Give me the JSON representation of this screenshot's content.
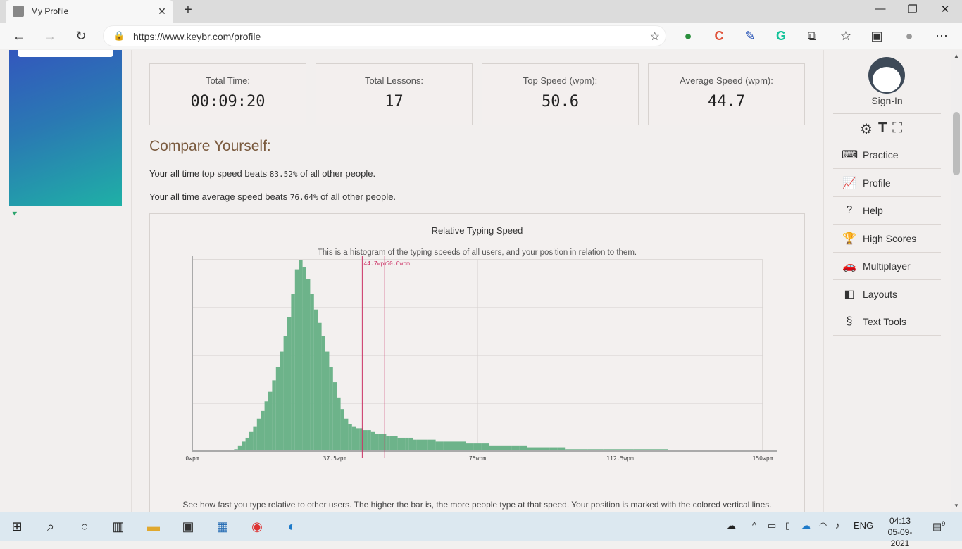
{
  "browser": {
    "tab_title": "My Profile",
    "url": "https://www.keybr.com/profile"
  },
  "stats": [
    {
      "label": "Total Time:",
      "value": "00:09:20"
    },
    {
      "label": "Total Lessons:",
      "value": "17"
    },
    {
      "label": "Top Speed (wpm):",
      "value": "50.6"
    },
    {
      "label": "Average Speed (wpm):",
      "value": "44.7"
    }
  ],
  "compare": {
    "title": "Compare Yourself:",
    "line1_pre": "Your all time top speed beats ",
    "line1_pct": "83.52%",
    "line1_post": " of all other people.",
    "line2_pre": "Your all time average speed beats ",
    "line2_pct": "76.64%",
    "line2_post": " of all other people."
  },
  "chart_data": {
    "type": "bar",
    "title": "Relative Typing Speed",
    "subtitle": "This is a histogram of the typing speeds of all users, and your position in relation to them.",
    "footer": "See how fast you type relative to other users. The higher the bar is, the more people type at that speed. Your position is marked with the colored vertical lines.",
    "xlim": [
      0,
      150
    ],
    "x_ticks": [
      "0wpm",
      "37.5wpm",
      "75wpm",
      "112.5wpm",
      "150wpm"
    ],
    "bar_color": "#6db38a",
    "marker_color": "#cc3366",
    "markers": [
      {
        "label": "44.7wpm",
        "x": 44.7
      },
      {
        "label": "50.6wpm",
        "x": 50.6
      }
    ],
    "x": [
      11,
      12,
      13,
      14,
      15,
      16,
      17,
      18,
      19,
      20,
      21,
      22,
      23,
      24,
      25,
      26,
      27,
      28,
      29,
      30,
      31,
      32,
      33,
      34,
      35,
      36,
      37,
      38,
      39,
      40,
      41,
      42,
      43,
      44,
      45,
      46,
      47,
      48,
      49,
      50,
      51,
      52,
      53,
      54,
      55,
      56,
      57,
      58,
      59,
      60,
      62,
      64,
      66,
      68,
      70,
      72,
      74,
      76,
      78,
      80,
      82,
      84,
      86,
      88,
      90,
      92,
      94,
      96,
      98,
      100,
      104,
      108,
      112,
      116,
      120,
      125,
      130
    ],
    "values": [
      1,
      3,
      5,
      7,
      10,
      13,
      17,
      21,
      26,
      31,
      37,
      44,
      52,
      60,
      70,
      82,
      95,
      100,
      96,
      90,
      82,
      74,
      67,
      60,
      52,
      44,
      36,
      28,
      22,
      17,
      14,
      13,
      12,
      12,
      11,
      11,
      10,
      9,
      9,
      9,
      8,
      8,
      8,
      7,
      7,
      7,
      7,
      6,
      6,
      6,
      6,
      5,
      5,
      5,
      5,
      4,
      4,
      4,
      3,
      3,
      3,
      3,
      3,
      2,
      2,
      2,
      2,
      2,
      1,
      1,
      1,
      1,
      1,
      1,
      1,
      0.5,
      0.5
    ]
  },
  "sidebar": {
    "signin": "Sign-In",
    "items": [
      {
        "label": "Practice",
        "icon": "⌨"
      },
      {
        "label": "Profile",
        "icon": "📈"
      },
      {
        "label": "Help",
        "icon": "?"
      },
      {
        "label": "High Scores",
        "icon": "🏆"
      },
      {
        "label": "Multiplayer",
        "icon": "🚗"
      },
      {
        "label": "Layouts",
        "icon": "◧"
      },
      {
        "label": "Text Tools",
        "icon": "§"
      }
    ]
  },
  "taskbar": {
    "lang": "ENG",
    "time": "04:13",
    "date": "05-09-2021",
    "notif_count": "9"
  }
}
